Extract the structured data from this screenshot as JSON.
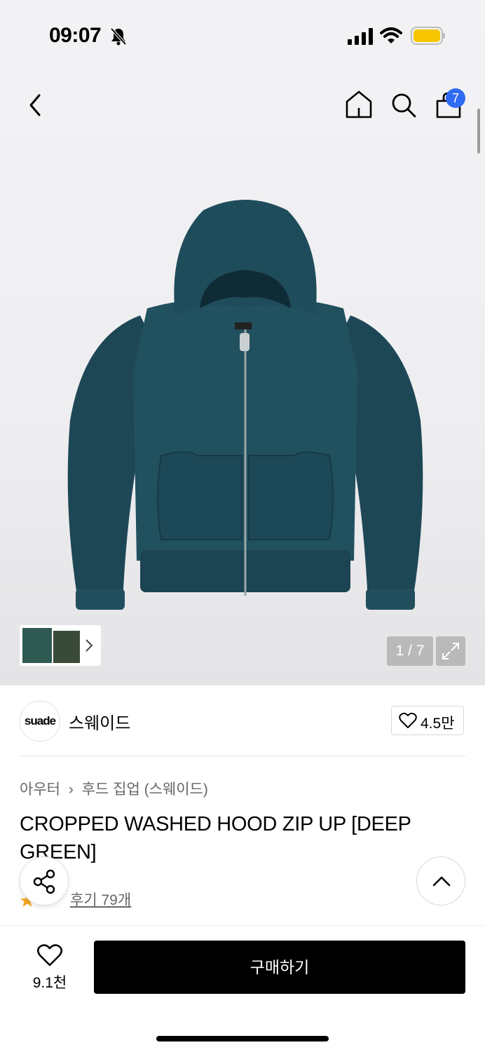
{
  "status_bar": {
    "time": "09:07"
  },
  "header": {
    "cart_count": "7"
  },
  "gallery": {
    "counter": "1 / 7"
  },
  "brand": {
    "logo_text": "suade",
    "name": "스웨이드",
    "like_count": "4.5만"
  },
  "breadcrumb": {
    "category": "아우터",
    "subcategory": "후드 집업 (스웨이드)"
  },
  "product": {
    "title": "CROPPED WASHED HOOD ZIP UP [DEEP GREEN]",
    "review_link": "후기 79개"
  },
  "bottom_bar": {
    "wish_count": "9.1천",
    "buy_label": "구매하기"
  },
  "colors": {
    "garment": "#1f4a57",
    "badge": "#2f6bf2",
    "rating_star": "#f5a623",
    "battery": "#f7c600"
  }
}
